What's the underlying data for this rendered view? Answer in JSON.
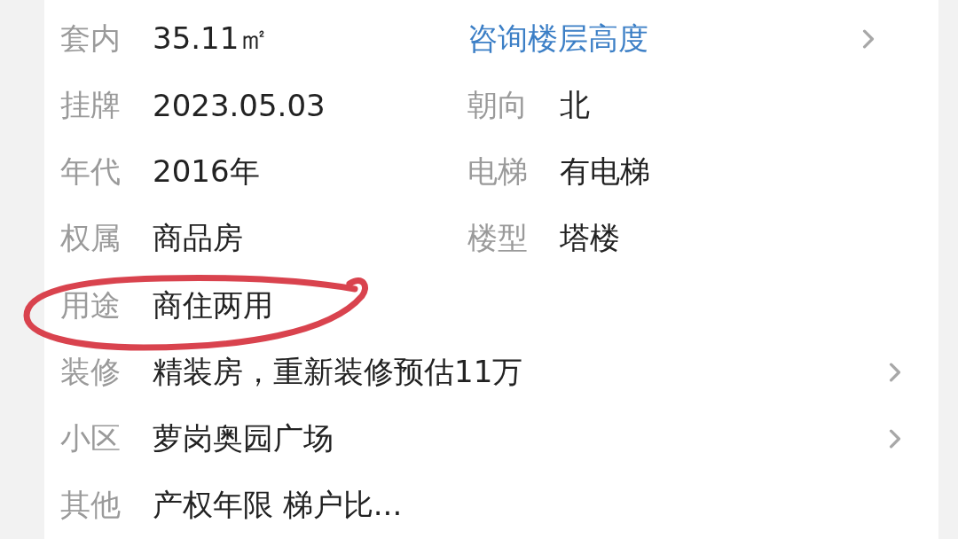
{
  "rows": [
    {
      "kind": "pair",
      "left": {
        "label": "套内",
        "value": "35.11㎡"
      },
      "right": {
        "value": "咨询楼层高度",
        "kind": "link"
      },
      "chevron": true
    },
    {
      "kind": "pair",
      "left": {
        "label": "挂牌",
        "value": "2023.05.03"
      },
      "right": {
        "label": "朝向",
        "value": "北"
      },
      "chevron": false
    },
    {
      "kind": "pair",
      "left": {
        "label": "年代",
        "value": "2016年"
      },
      "right": {
        "label": "电梯",
        "value": "有电梯"
      },
      "chevron": false
    },
    {
      "kind": "pair",
      "left": {
        "label": "权属",
        "value": "商品房"
      },
      "right": {
        "label": "楼型",
        "value": "塔楼"
      },
      "chevron": false
    },
    {
      "kind": "single",
      "left": {
        "label": "用途",
        "value": "商住两用"
      },
      "chevron": false
    },
    {
      "kind": "single",
      "left": {
        "label": "装修",
        "value": "精装房，重新装修预估11万"
      },
      "chevron": true
    },
    {
      "kind": "single",
      "left": {
        "label": "小区",
        "value": "萝岗奥园广场"
      },
      "chevron": true
    },
    {
      "kind": "single",
      "left": {
        "label": "其他",
        "value": "产权年限 梯户比..."
      },
      "chevron": false
    }
  ],
  "annotation": {
    "kind": "circle",
    "color": "#d9434e"
  }
}
